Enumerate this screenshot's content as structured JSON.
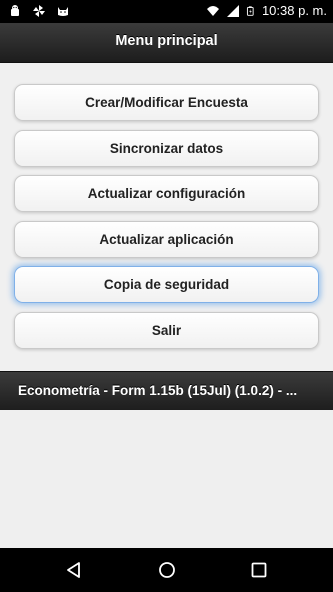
{
  "status_bar": {
    "time": "10:38 p. m.",
    "icons": [
      "android-icon",
      "pinwheel-icon",
      "cat-icon",
      "wifi-icon",
      "signal-icon",
      "battery-charging-icon"
    ]
  },
  "header": {
    "title": "Menu principal"
  },
  "menu": {
    "items": [
      {
        "label": "Crear/Modificar Encuesta"
      },
      {
        "label": "Sincronizar datos"
      },
      {
        "label": "Actualizar configuración"
      },
      {
        "label": "Actualizar aplicación"
      },
      {
        "label": "Copia de seguridad"
      },
      {
        "label": "Salir"
      }
    ],
    "focused_index": 4
  },
  "footer": {
    "text": "Econometría - Form 1.15b (15Jul) (1.0.2) - ..."
  },
  "nav_bar": {
    "icons": [
      "back-icon",
      "home-icon",
      "recents-icon"
    ]
  }
}
